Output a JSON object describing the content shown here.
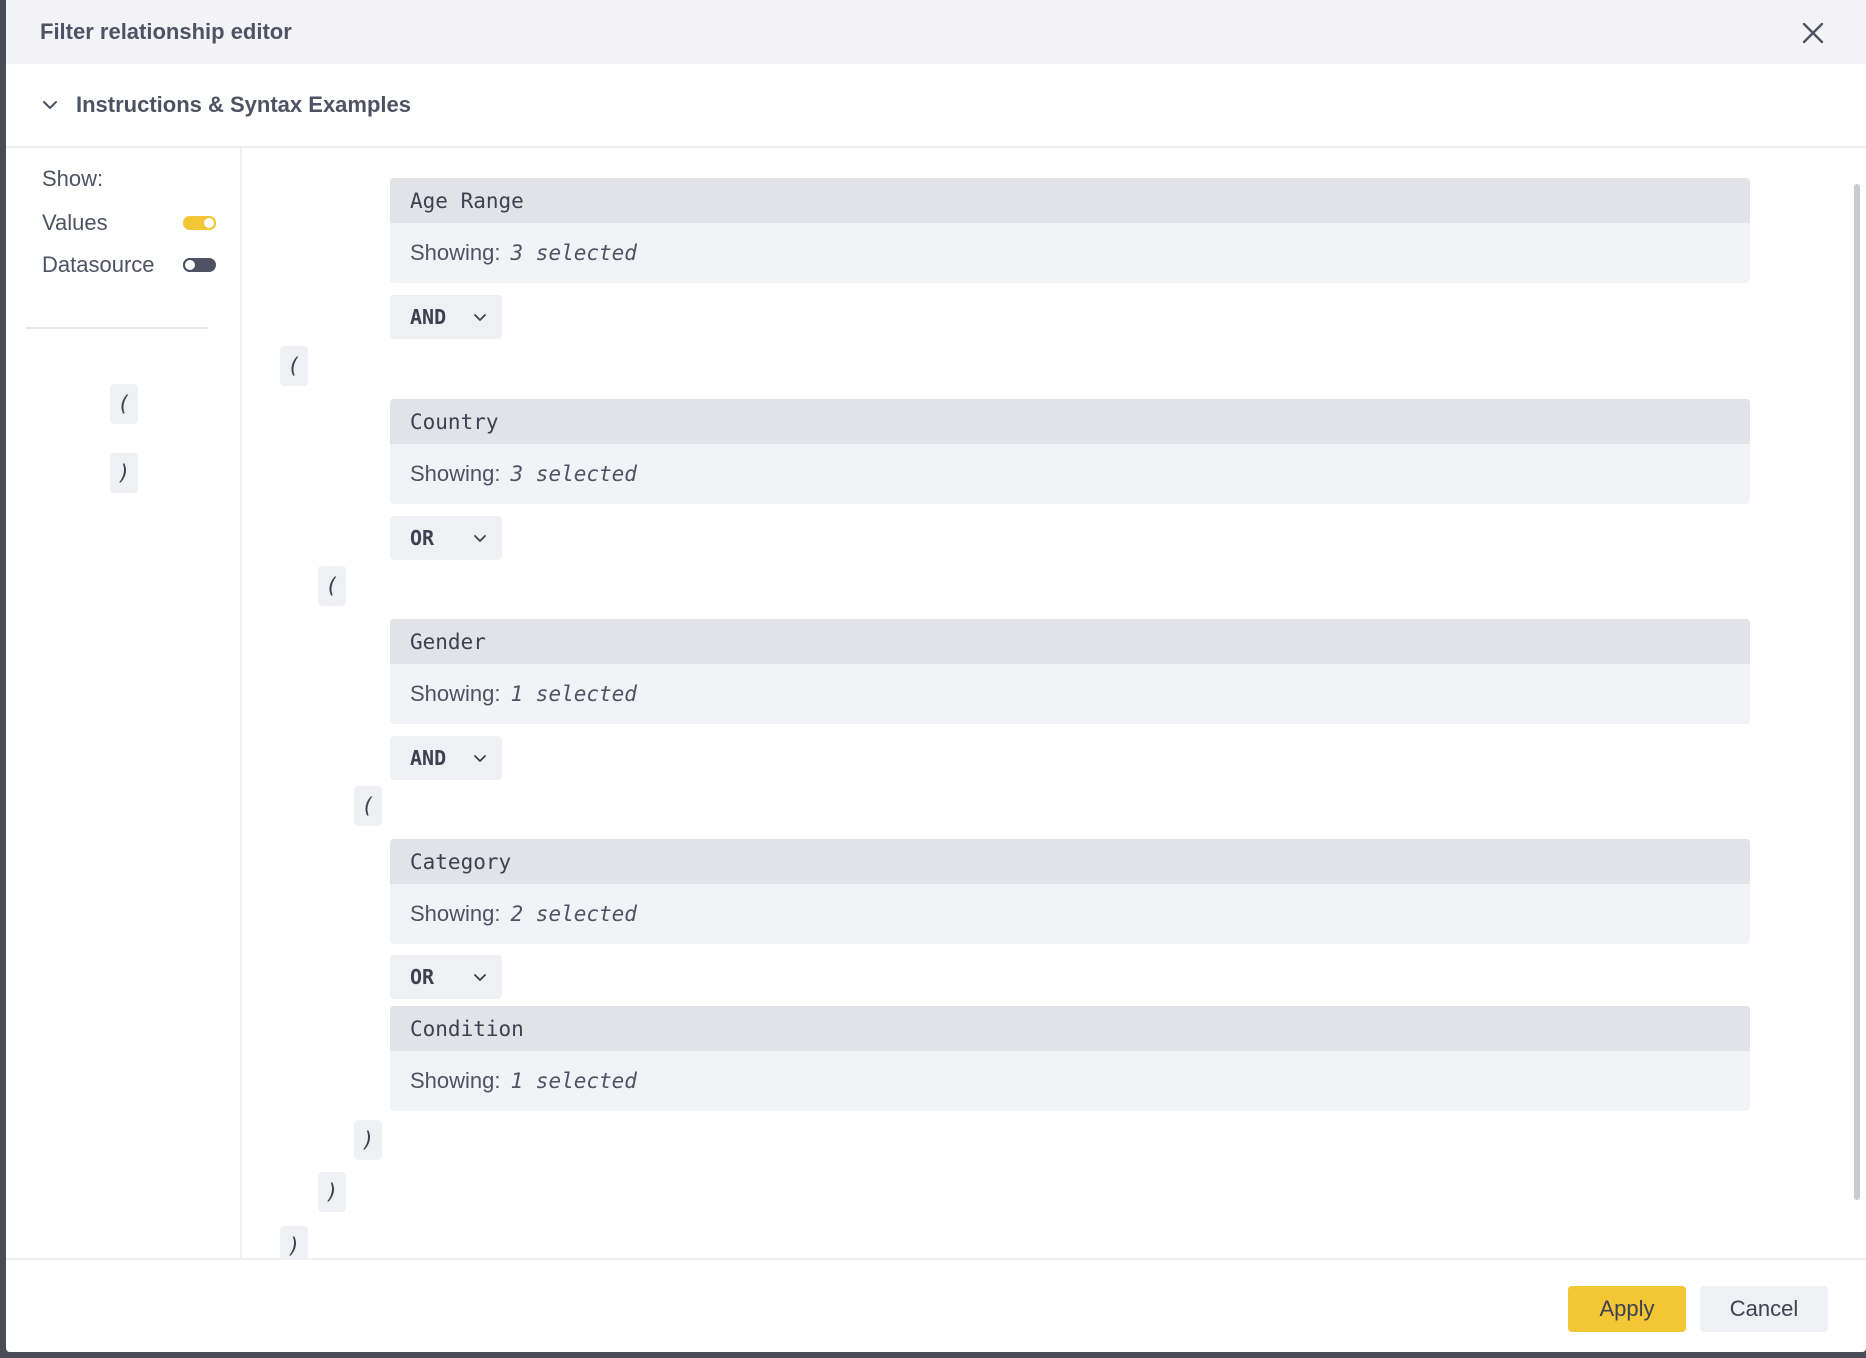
{
  "dialog": {
    "title": "Filter relationship editor"
  },
  "instructions": {
    "label": "Instructions & Syntax Examples"
  },
  "sidebar": {
    "show_label": "Show:",
    "toggles": [
      {
        "label": "Values",
        "state": "on"
      },
      {
        "label": "Datasource",
        "state": "off"
      }
    ],
    "open_paren": "(",
    "close_paren": ")"
  },
  "editor": {
    "showing_prefix": "Showing:",
    "filters": [
      {
        "name": "Age Range",
        "value": "3 selected"
      },
      {
        "name": "Country",
        "value": "3 selected"
      },
      {
        "name": "Gender",
        "value": "1 selected"
      },
      {
        "name": "Category",
        "value": "2 selected"
      },
      {
        "name": "Condition",
        "value": "1 selected"
      }
    ],
    "operators": [
      "AND",
      "OR",
      "AND",
      "OR"
    ],
    "open_paren": "(",
    "close_paren": ")"
  },
  "footer": {
    "apply_label": "Apply",
    "cancel_label": "Cancel"
  },
  "colors": {
    "accent": "#f3c635",
    "header_bg": "#f4f4f8",
    "card_head": "#e1e3e8",
    "card_body": "#f2f3f7",
    "text": "#3d4150"
  },
  "icons": {
    "close": "close-icon",
    "chevron": "chevron-down-icon"
  }
}
